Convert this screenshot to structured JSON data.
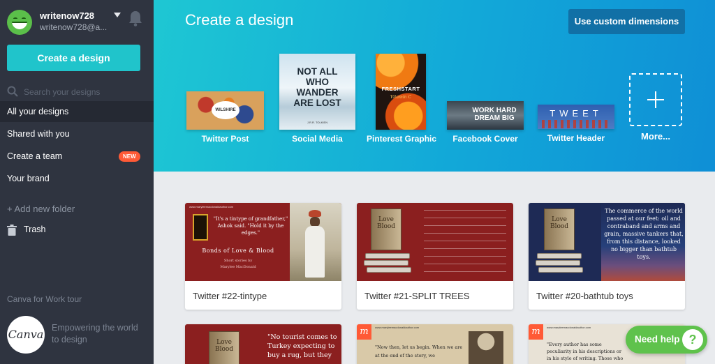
{
  "user": {
    "name": "writenow728",
    "email": "writenow728@a..."
  },
  "sidebar": {
    "create_button": "Create a design",
    "search_placeholder": "Search your designs",
    "nav": [
      {
        "label": "All your designs",
        "active": true
      },
      {
        "label": "Shared with you"
      },
      {
        "label": "Create a team",
        "badge": "NEW"
      },
      {
        "label": "Your brand"
      }
    ],
    "add_folder": "+ Add new folder",
    "trash": "Trash",
    "tour": "Canva for Work tour",
    "logo_text": "Canva",
    "tagline": "Empowering the world to design"
  },
  "hero": {
    "title": "Create a design",
    "custom_button": "Use custom dimensions",
    "templates": [
      {
        "label": "Twitter Post",
        "thumb_text": "WILSHIRE"
      },
      {
        "label": "Social Media",
        "thumb_text": "NOT ALL WHO WANDER ARE LOST",
        "thumb_sub": "J.R.R. TOLKIEN"
      },
      {
        "label": "Pinterest Graphic",
        "thumb_text": "FRESHSTART",
        "thumb_sub": "Vitamin C"
      },
      {
        "label": "Facebook Cover",
        "thumb_text": "WORK HARD DREAM BIG"
      },
      {
        "label": "Twitter Header",
        "thumb_text": "TWEET"
      }
    ],
    "more_label": "More..."
  },
  "designs": [
    {
      "title": "Twitter #22-tintype",
      "url": "www.maryleemacdonaldauthor.com",
      "quote": "\"It's a tintype of grandfather,\" Ashok said. \"Hold it by the edges.\"",
      "book_title": "Bonds of Love & Blood",
      "sub": "Short stories by",
      "author": "Marylee MacDonald"
    },
    {
      "title": "Twitter #21-SPLIT TREES",
      "book_title": "Love Blood"
    },
    {
      "title": "Twitter #20-bathtub toys",
      "book_title": "Love Blood",
      "quote": "The commerce of the world passed at our feet: oil and contraband and arms and grain, massive tankers that, from this distance, looked no bigger than bathtub toys."
    },
    {
      "book_title": "Love Blood",
      "quote": "\"No tourist comes to Turkey expecting to buy a rug, but they"
    },
    {
      "url": "www.maryleemacdonaldauthor.com",
      "quote": "\"Now then, let us begin. When we are at the end of the story, we"
    },
    {
      "url": "www.maryleemacdonaldauthor.com",
      "quote": "\"Every author has some peculiarity in his descriptions or in his style of writing. Those who"
    }
  ],
  "help": {
    "label": "Need help",
    "icon_text": "?"
  },
  "colors": {
    "sidebar": "#2f3440",
    "accent": "#20c4cb",
    "hero_start": "#1ec7d3",
    "hero_end": "#0f8fd6",
    "new_badge": "#ff5a36",
    "help": "#5fc24c"
  }
}
